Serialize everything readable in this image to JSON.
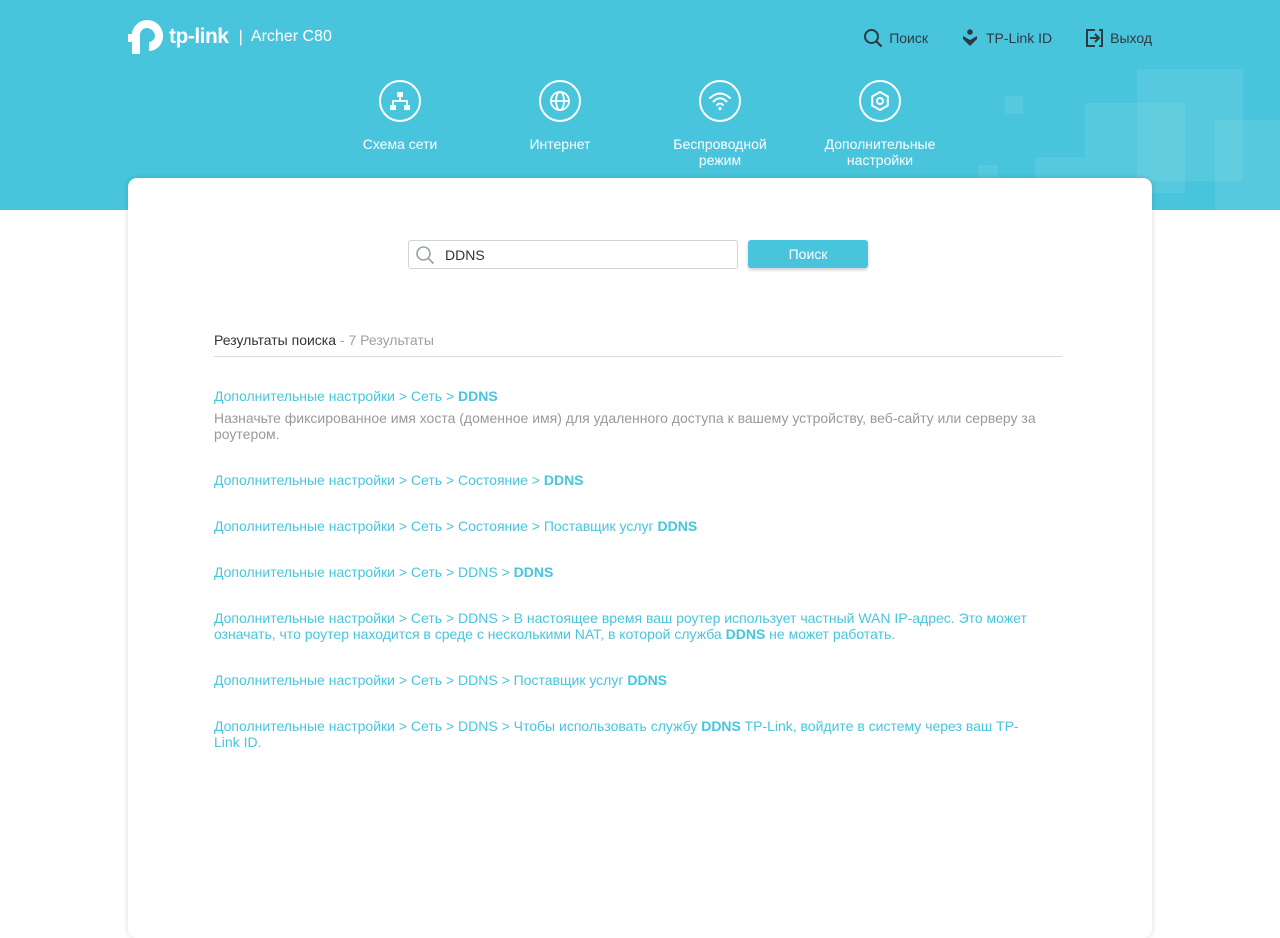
{
  "header": {
    "brand": "tp-link",
    "model": "Archer C80",
    "actions": [
      {
        "label": "Поиск",
        "icon": "search-icon"
      },
      {
        "label": "TP-Link ID",
        "icon": "tplink-id-icon"
      },
      {
        "label": "Выход",
        "icon": "logout-icon"
      }
    ]
  },
  "nav": [
    {
      "label": "Схема сети",
      "icon": "network-map-icon"
    },
    {
      "label": "Интернет",
      "icon": "globe-icon"
    },
    {
      "label": "Беспроводной\nрежим",
      "icon": "wifi-icon"
    },
    {
      "label": "Дополнительные\nнастройки",
      "icon": "gear-icon"
    }
  ],
  "search": {
    "value": "DDNS",
    "button_label": "Поиск"
  },
  "results": {
    "title": "Результаты поиска",
    "count": " - 7 Результаты",
    "items": [
      {
        "prefix": "Дополнительные настройки > Сеть > ",
        "keyword": "DDNS",
        "suffix": "",
        "description": "Назначьте фиксированное имя хоста (доменное имя) для удаленного доступа к вашему устройству, веб-сайту или серверу за роутером."
      },
      {
        "prefix": "Дополнительные настройки > Сеть > Состояние > ",
        "keyword": "DDNS",
        "suffix": ""
      },
      {
        "prefix": "Дополнительные настройки > Сеть > Состояние > Поставщик услуг ",
        "keyword": "DDNS",
        "suffix": ""
      },
      {
        "prefix": "Дополнительные настройки > Сеть > DDNS > ",
        "keyword": "DDNS",
        "suffix": ""
      },
      {
        "prefix": "Дополнительные настройки > Сеть > DDNS > В настоящее время ваш роутер использует частный WAN IP-адрес. Это может означать, что роутер находится в среде с несколькими NAT, в которой служба ",
        "keyword": "DDNS",
        "suffix": " не может работать."
      },
      {
        "prefix": "Дополнительные настройки > Сеть > DDNS > Поставщик услуг ",
        "keyword": "DDNS",
        "suffix": ""
      },
      {
        "prefix": "Дополнительные настройки > Сеть > DDNS > Чтобы использовать службу ",
        "keyword": "DDNS",
        "suffix": " TP-Link, войдите в систему через ваш TP-Link ID."
      }
    ]
  },
  "colors": {
    "accent": "#48c5dc",
    "text_dark": "#333333",
    "text_muted": "#999999"
  }
}
